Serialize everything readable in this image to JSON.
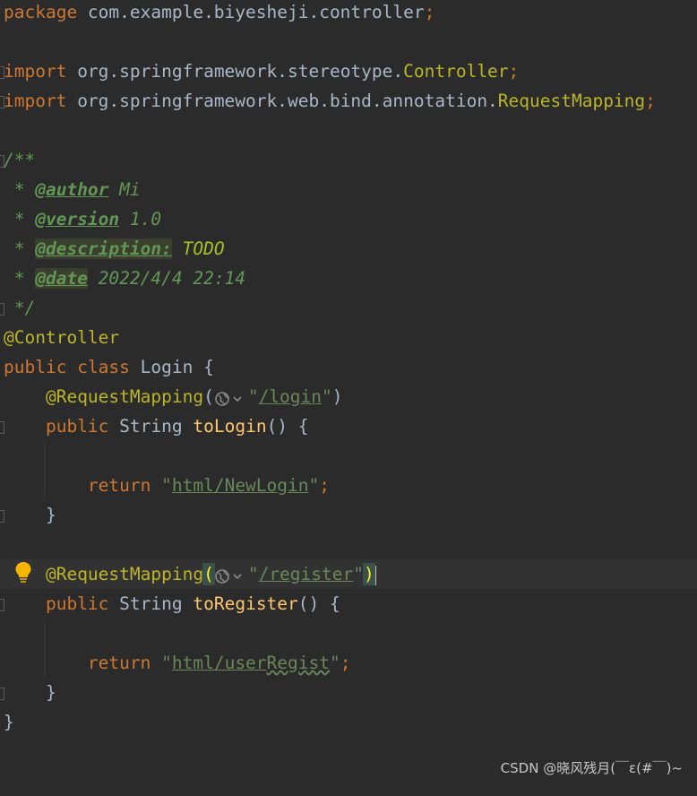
{
  "code": {
    "package_kw": "package",
    "package_name": " com.example.biyesheji.controller",
    "semicolon": ";",
    "import_kw": "import",
    "import1_path": " org.springframework.stereotype.",
    "import1_class": "Controller",
    "import2_path": " org.springframework.web.bind.annotation.",
    "import2_class": "RequestMapping",
    "doc_open": "/**",
    "doc_star": " * ",
    "doc_author_tag": "@author",
    "doc_author_val": " Mi",
    "doc_version_tag": "@version",
    "doc_version_val": " 1.0",
    "doc_desc_tag": "@description:",
    "doc_desc_val": " TODO",
    "doc_date_tag": "@date",
    "doc_date_val": " 2022/4/4 22:14",
    "doc_close": " */",
    "controller_ann": "@Controller",
    "public_kw": "public",
    "class_kw": "class",
    "class_name": " Login {",
    "request_mapping": "@RequestMapping",
    "paren_open": "(",
    "paren_close": ")",
    "quote": "\"",
    "login_path": "/login",
    "string_type": "String",
    "method_login": "toLogin",
    "method_parens": "() {",
    "return_kw": "return",
    "login_return_a": "html/NewLogin",
    "close_brace": "}",
    "register_path": "/register",
    "method_register": "toRegister",
    "register_return_a": "html/user",
    "register_return_b": "Regist",
    "class_close": "}"
  },
  "watermark": "CSDN @晓风残月(￣ε(#￣)~",
  "icons": {
    "url_globe": "globe-dropdown-icon",
    "intention": "lightbulb-icon"
  },
  "colors": {
    "background": "#2b2b2b",
    "keyword": "#cc7832",
    "annotation": "#bbb529",
    "string": "#6a8759",
    "doc": "#629755",
    "method": "#ffc66d"
  }
}
